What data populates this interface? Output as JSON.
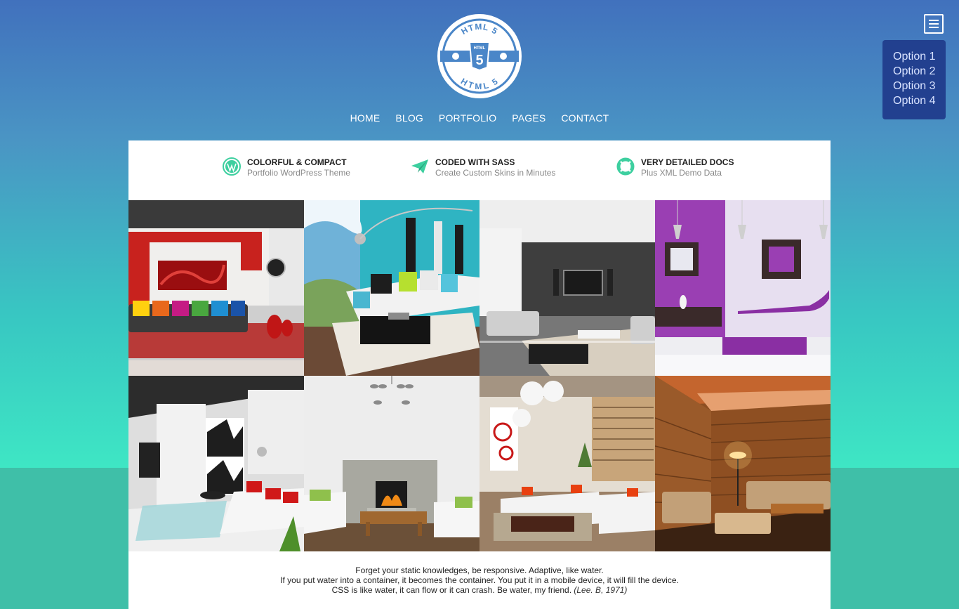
{
  "logo": {
    "top_text": "HTML 5",
    "badge_text": "HTML",
    "badge_number": "5",
    "bottom_text": "HTML 5"
  },
  "nav": {
    "items": [
      "HOME",
      "BLOG",
      "PORTFOLIO",
      "PAGES",
      "CONTACT"
    ]
  },
  "menu": {
    "options": [
      "Option 1",
      "Option 2",
      "Option 3",
      "Option 4"
    ]
  },
  "features": [
    {
      "icon": "wordpress-icon",
      "title": "COLORFUL & COMPACT",
      "subtitle": "Portfolio WordPress Theme"
    },
    {
      "icon": "paper-plane-icon",
      "title": "CODED WITH SASS",
      "subtitle": "Create Custom Skins in Minutes"
    },
    {
      "icon": "life-ring-icon",
      "title": "VERY DETAILED DOCS",
      "subtitle": "Plus XML Demo Data"
    }
  ],
  "quote": {
    "line1": "Forget your static knowledges, be responsive. Adaptive, like water.",
    "line2": "If you put water into a container, it becomes the container. You put it in a mobile device, it will fill the device.",
    "line3": "CSS is like water, it can flow or it can crash. Be water, my friend.",
    "attribution": "(Lee. B, 1971)"
  },
  "colors": {
    "accent": "#3dcf9f",
    "logo_blue": "#4a86c8",
    "menu_bg": "#22408f"
  }
}
